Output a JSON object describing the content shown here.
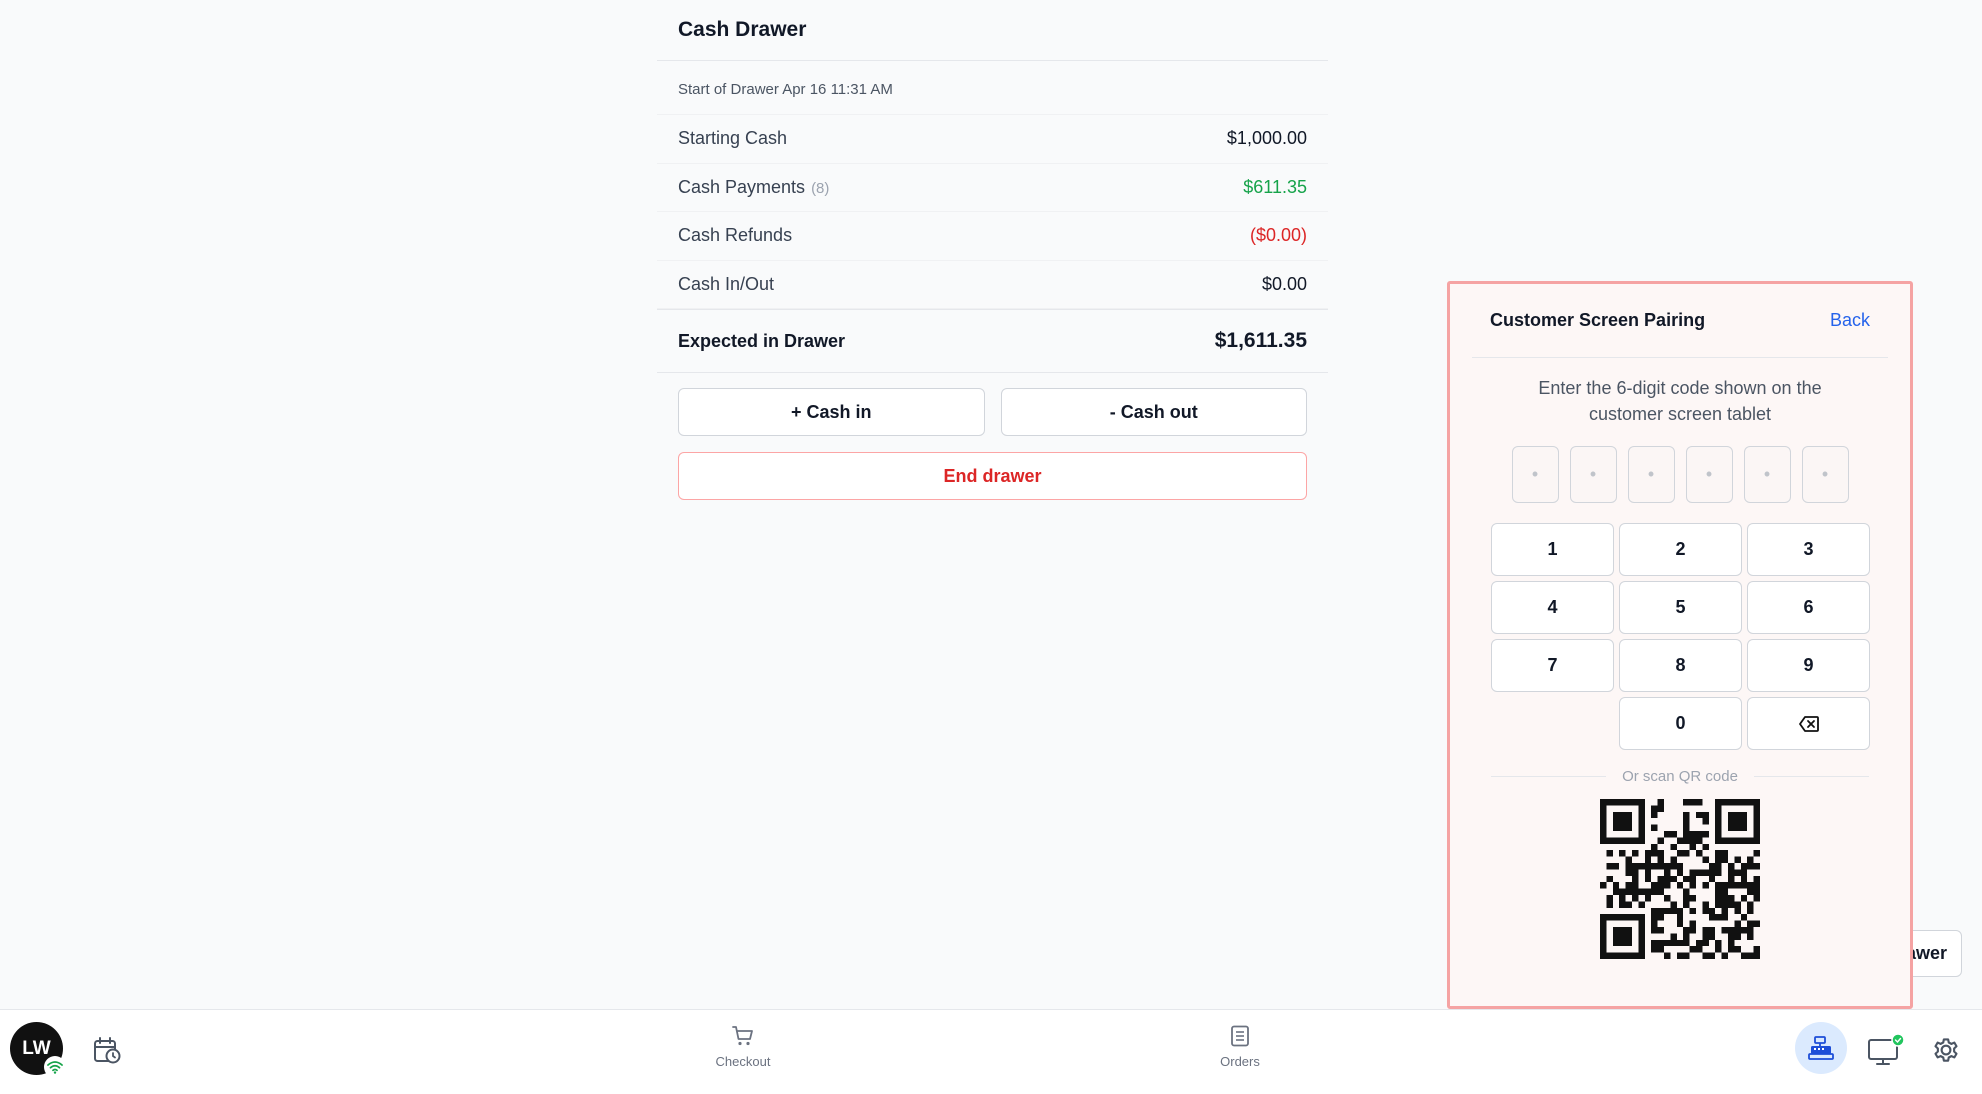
{
  "drawer": {
    "title": "Cash Drawer",
    "start_label": "Start of Drawer Apr 16 11:31 AM",
    "rows": [
      {
        "label": "Starting Cash",
        "value": "$1,000.00"
      },
      {
        "label": "Cash Payments",
        "count": "(8)",
        "value": "$611.35",
        "color": "#16a34a"
      },
      {
        "label": "Cash Refunds",
        "value": "($0.00)",
        "color": "#dc2626"
      },
      {
        "label": "Cash In/Out",
        "value": "$0.00"
      }
    ],
    "total": {
      "label": "Expected in Drawer",
      "value": "$1,611.35"
    },
    "cash_in_label": "+ Cash in",
    "cash_out_label": "- Cash out",
    "end_label": "End drawer"
  },
  "peek_button_label": "awer",
  "pairing": {
    "title": "Customer Screen Pairing",
    "back_label": "Back",
    "instruction": "Enter the 6-digit code shown on the customer screen tablet",
    "code_placeholder": "•",
    "keys": [
      "1",
      "2",
      "3",
      "4",
      "5",
      "6",
      "7",
      "8",
      "9",
      "",
      "0"
    ],
    "backspace_icon": "backspace-icon",
    "divider_text": "Or scan QR code"
  },
  "bottombar": {
    "avatar_initials": "LW",
    "checkout_label": "Checkout",
    "orders_label": "Orders"
  },
  "colors": {
    "accent": "#2563eb",
    "positive": "#16a34a",
    "negative": "#dc2626",
    "modal_border": "#f5a3a3"
  }
}
